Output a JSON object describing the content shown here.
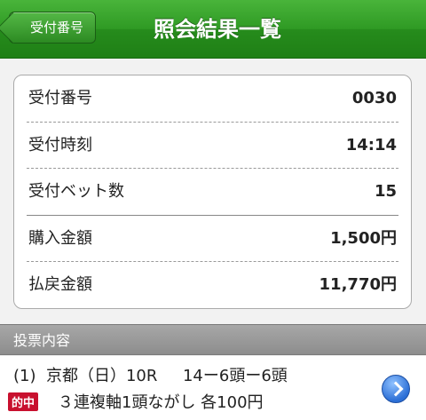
{
  "header": {
    "back_label": "受付番号",
    "title": "照会結果一覧"
  },
  "summary": [
    {
      "key": "受付番号",
      "value": "0030"
    },
    {
      "key": "受付時刻",
      "value": "14:14"
    },
    {
      "key": "受付ベット数",
      "value": "15"
    },
    {
      "key": "購入金額",
      "value": "1,500円"
    },
    {
      "key": "払戻金額",
      "value": "11,770円"
    }
  ],
  "section": {
    "label": "投票内容"
  },
  "bet": {
    "line1": "(1)  京都（日）10R     14ー6頭ー6頭",
    "badge": "的中",
    "line2": "３連複軸1頭ながし 各100円"
  },
  "colors": {
    "header_green": "#2f9a24",
    "hit_red": "#c8102e",
    "section_gray": "#9a9a9a"
  }
}
